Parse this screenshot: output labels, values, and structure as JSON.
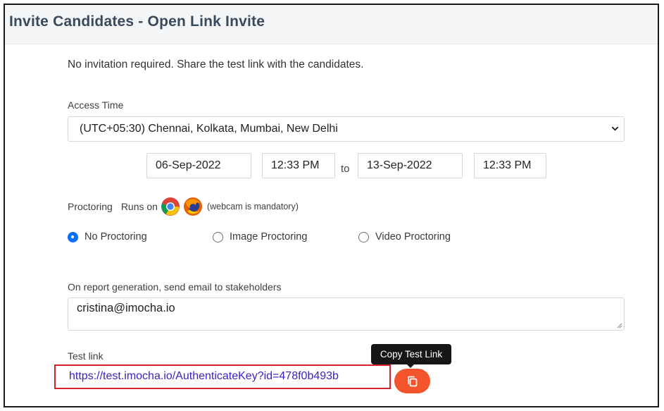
{
  "header": {
    "title": "Invite Candidates - Open Link Invite"
  },
  "info_text": "No invitation required. Share the test link with the candidates.",
  "access_time": {
    "label": "Access Time",
    "timezone_value": "(UTC+05:30) Chennai, Kolkata, Mumbai, New Delhi",
    "start_date": "06-Sep-2022",
    "start_time": "12:33 PM",
    "separator": "to",
    "end_date": "13-Sep-2022",
    "end_time": "12:33 PM"
  },
  "proctoring": {
    "label": "Proctoring",
    "runs_on": "Runs on",
    "browsers": [
      "chrome-icon",
      "firefox-icon"
    ],
    "note": "(webcam is mandatory)",
    "options": [
      {
        "label": "No Proctoring",
        "checked": true
      },
      {
        "label": "Image Proctoring",
        "checked": false
      },
      {
        "label": "Video Proctoring",
        "checked": false
      }
    ]
  },
  "stakeholders": {
    "label": "On report generation, send email to stakeholders",
    "value": "cristina@imocha.io"
  },
  "test_link": {
    "label": "Test link",
    "url": "https://test.imocha.io/AuthenticateKey?id=478f0b493b",
    "copy_tooltip": "Copy Test Link",
    "copy_icon": "copy-icon"
  },
  "colors": {
    "accent_orange": "#f4542b",
    "link_purple": "#3b23c7",
    "highlight_red": "#d3232c",
    "radio_blue": "#0b6ef6"
  }
}
